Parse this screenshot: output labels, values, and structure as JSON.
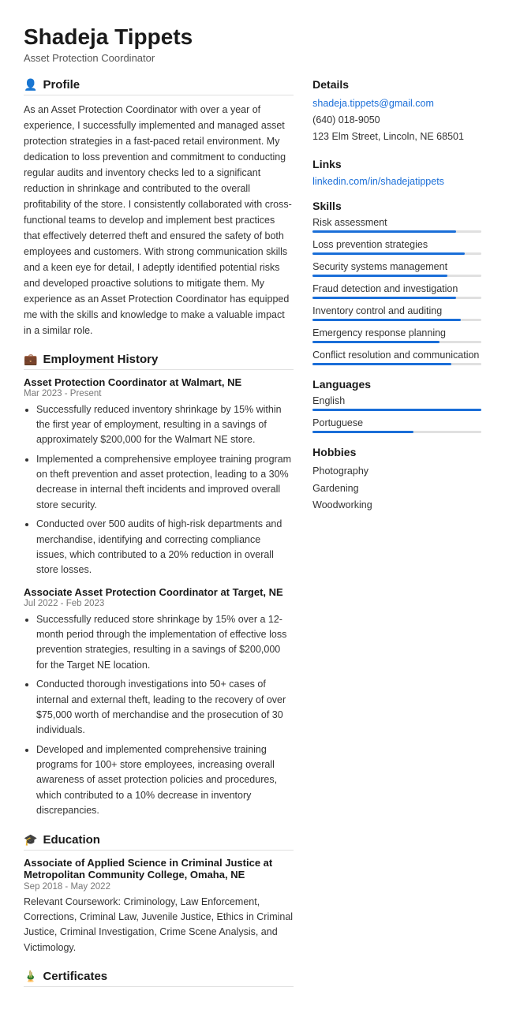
{
  "header": {
    "name": "Shadeja Tippets",
    "title": "Asset Protection Coordinator"
  },
  "profile": {
    "section_title": "Profile",
    "icon": "👤",
    "text": "As an Asset Protection Coordinator with over a year of experience, I successfully implemented and managed asset protection strategies in a fast-paced retail environment. My dedication to loss prevention and commitment to conducting regular audits and inventory checks led to a significant reduction in shrinkage and contributed to the overall profitability of the store. I consistently collaborated with cross-functional teams to develop and implement best practices that effectively deterred theft and ensured the safety of both employees and customers. With strong communication skills and a keen eye for detail, I adeptly identified potential risks and developed proactive solutions to mitigate them. My experience as an Asset Protection Coordinator has equipped me with the skills and knowledge to make a valuable impact in a similar role."
  },
  "employment": {
    "section_title": "Employment History",
    "icon": "💼",
    "jobs": [
      {
        "title": "Asset Protection Coordinator at Walmart, NE",
        "date": "Mar 2023 - Present",
        "bullets": [
          "Successfully reduced inventory shrinkage by 15% within the first year of employment, resulting in a savings of approximately $200,000 for the Walmart NE store.",
          "Implemented a comprehensive employee training program on theft prevention and asset protection, leading to a 30% decrease in internal theft incidents and improved overall store security.",
          "Conducted over 500 audits of high-risk departments and merchandise, identifying and correcting compliance issues, which contributed to a 20% reduction in overall store losses."
        ]
      },
      {
        "title": "Associate Asset Protection Coordinator at Target, NE",
        "date": "Jul 2022 - Feb 2023",
        "bullets": [
          "Successfully reduced store shrinkage by 15% over a 12-month period through the implementation of effective loss prevention strategies, resulting in a savings of $200,000 for the Target NE location.",
          "Conducted thorough investigations into 50+ cases of internal and external theft, leading to the recovery of over $75,000 worth of merchandise and the prosecution of 30 individuals.",
          "Developed and implemented comprehensive training programs for 100+ store employees, increasing overall awareness of asset protection policies and procedures, which contributed to a 10% decrease in inventory discrepancies."
        ]
      }
    ]
  },
  "education": {
    "section_title": "Education",
    "icon": "🎓",
    "entries": [
      {
        "title": "Associate of Applied Science in Criminal Justice at Metropolitan Community College, Omaha, NE",
        "date": "Sep 2018 - May 2022",
        "description": "Relevant Coursework: Criminology, Law Enforcement, Corrections, Criminal Law, Juvenile Justice, Ethics in Criminal Justice, Criminal Investigation, Crime Scene Analysis, and Victimology."
      }
    ]
  },
  "certificates": {
    "section_title": "Certificates",
    "icon": "🏅"
  },
  "details": {
    "section_title": "Details",
    "email": "shadeja.tippets@gmail.com",
    "phone": "(640) 018-9050",
    "address": "123 Elm Street, Lincoln, NE 68501"
  },
  "links": {
    "section_title": "Links",
    "linkedin": "linkedin.com/in/shadejatippets"
  },
  "skills": {
    "section_title": "Skills",
    "items": [
      {
        "name": "Risk assessment",
        "level": 85
      },
      {
        "name": "Loss prevention strategies",
        "level": 90
      },
      {
        "name": "Security systems management",
        "level": 80
      },
      {
        "name": "Fraud detection and investigation",
        "level": 85
      },
      {
        "name": "Inventory control and auditing",
        "level": 88
      },
      {
        "name": "Emergency response planning",
        "level": 75
      },
      {
        "name": "Conflict resolution and communication",
        "level": 82
      }
    ]
  },
  "languages": {
    "section_title": "Languages",
    "items": [
      {
        "name": "English",
        "level": 100
      },
      {
        "name": "Portuguese",
        "level": 60
      }
    ]
  },
  "hobbies": {
    "section_title": "Hobbies",
    "items": [
      "Photography",
      "Gardening",
      "Woodworking"
    ]
  }
}
